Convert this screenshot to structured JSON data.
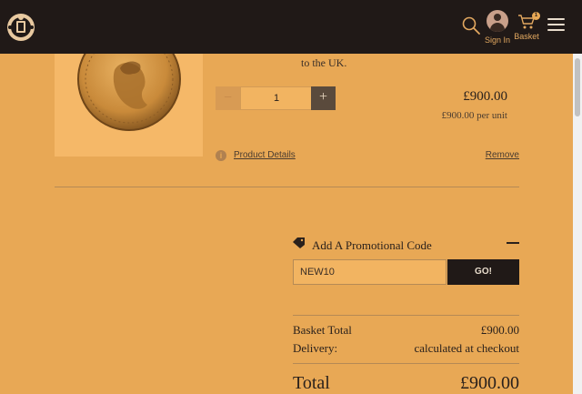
{
  "header": {
    "signin_label": "Sign In",
    "basket_label": "Basket",
    "basket_count": "1"
  },
  "product": {
    "shipping_note": "to the UK.",
    "quantity": "1",
    "price": "£900.00",
    "unit_price": "£900.00 per unit",
    "details_link": "Product Details",
    "remove_link": "Remove",
    "qty_minus": "−",
    "qty_plus": "+",
    "info_glyph": "i"
  },
  "promo": {
    "title": "Add A Promotional Code",
    "input_value": "NEW10",
    "button_label": "GO!"
  },
  "summary": {
    "basket_total_label": "Basket Total",
    "basket_total_value": "£900.00",
    "delivery_label": "Delivery:",
    "delivery_value": "calculated at checkout",
    "total_label": "Total",
    "total_value": "£900.00"
  },
  "colors": {
    "page_bg": "#e8a855",
    "header_bg": "#201917",
    "accent_text": "#e2a860",
    "button_dark": "#201917"
  },
  "icons": [
    "crest-logo-icon",
    "search-icon",
    "user-icon",
    "cart-icon",
    "menu-icon",
    "info-icon",
    "tag-icon"
  ]
}
